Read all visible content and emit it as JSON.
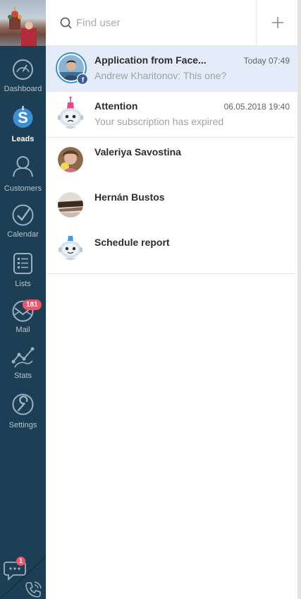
{
  "sidebar": {
    "items": [
      {
        "id": "dashboard",
        "label": "Dashboard"
      },
      {
        "id": "leads",
        "label": "Leads",
        "active": true
      },
      {
        "id": "customers",
        "label": "Customers"
      },
      {
        "id": "calendar",
        "label": "Calendar"
      },
      {
        "id": "lists",
        "label": "Lists"
      },
      {
        "id": "mail",
        "label": "Mail",
        "badge": "181"
      },
      {
        "id": "stats",
        "label": "Stats"
      },
      {
        "id": "settings",
        "label": "Settings"
      }
    ],
    "chat_badge": "1"
  },
  "search": {
    "placeholder": "Find user"
  },
  "chats": [
    {
      "title": "Application from Face...",
      "time": "Today 07:49",
      "preview": "Andrew Kharitonov: This one?",
      "selected": true,
      "avatar": "facebook-user-avatar"
    },
    {
      "title": "Attention",
      "time": "06.05.2018 19:40",
      "preview": "Your subscription has expired",
      "avatar": "robot-avatar"
    },
    {
      "title": "Valeriya Savostina",
      "time": "",
      "preview": "",
      "avatar": "user-avatar"
    },
    {
      "title": "Hernán Bustos",
      "time": "",
      "preview": "",
      "avatar": "user-avatar"
    },
    {
      "title": "Schedule report",
      "time": "",
      "preview": "",
      "avatar": "robot-avatar"
    }
  ],
  "colors": {
    "sidebar_bg": "#1d3f55",
    "selected_row": "#e3ecf8",
    "badge": "#e9556a",
    "accent": "#3d8fd4"
  }
}
